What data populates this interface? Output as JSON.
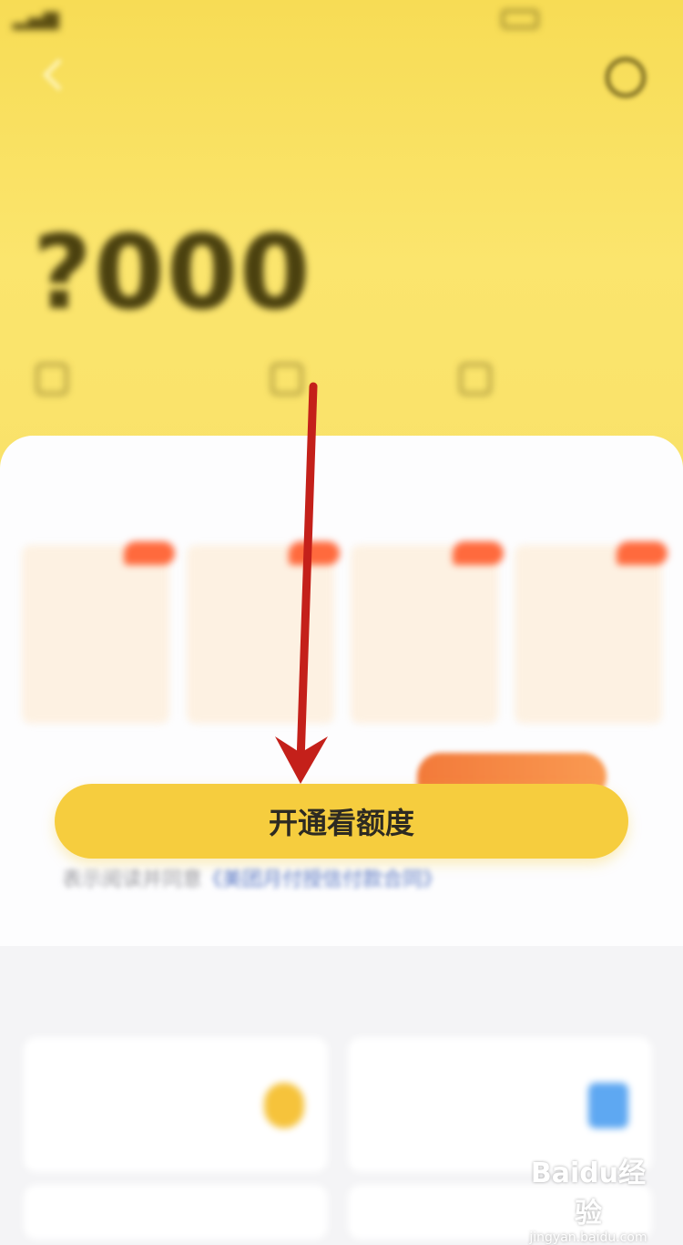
{
  "colors": {
    "header_yellow": "#f9e26a",
    "button_yellow": "#f6cd3e",
    "promo_orange": "#f27a3a",
    "annotation_red": "#c4201a",
    "link_blue": "#5a78c4"
  },
  "cta": {
    "label": "开通看额度"
  },
  "hero": {
    "amount": "?000"
  },
  "agreement": {
    "text_visible": "表示阅读并同意",
    "link_visible": "《美团月付授信付款合同》"
  },
  "icons": {
    "back": "back-arrow-icon",
    "service": "headset-icon",
    "annotation": "red-arrow-icon",
    "watermark": "baidu-jingyan-logo"
  },
  "watermark": {
    "logo": "Baidu经验",
    "url": "jingyan.baidu.com"
  }
}
